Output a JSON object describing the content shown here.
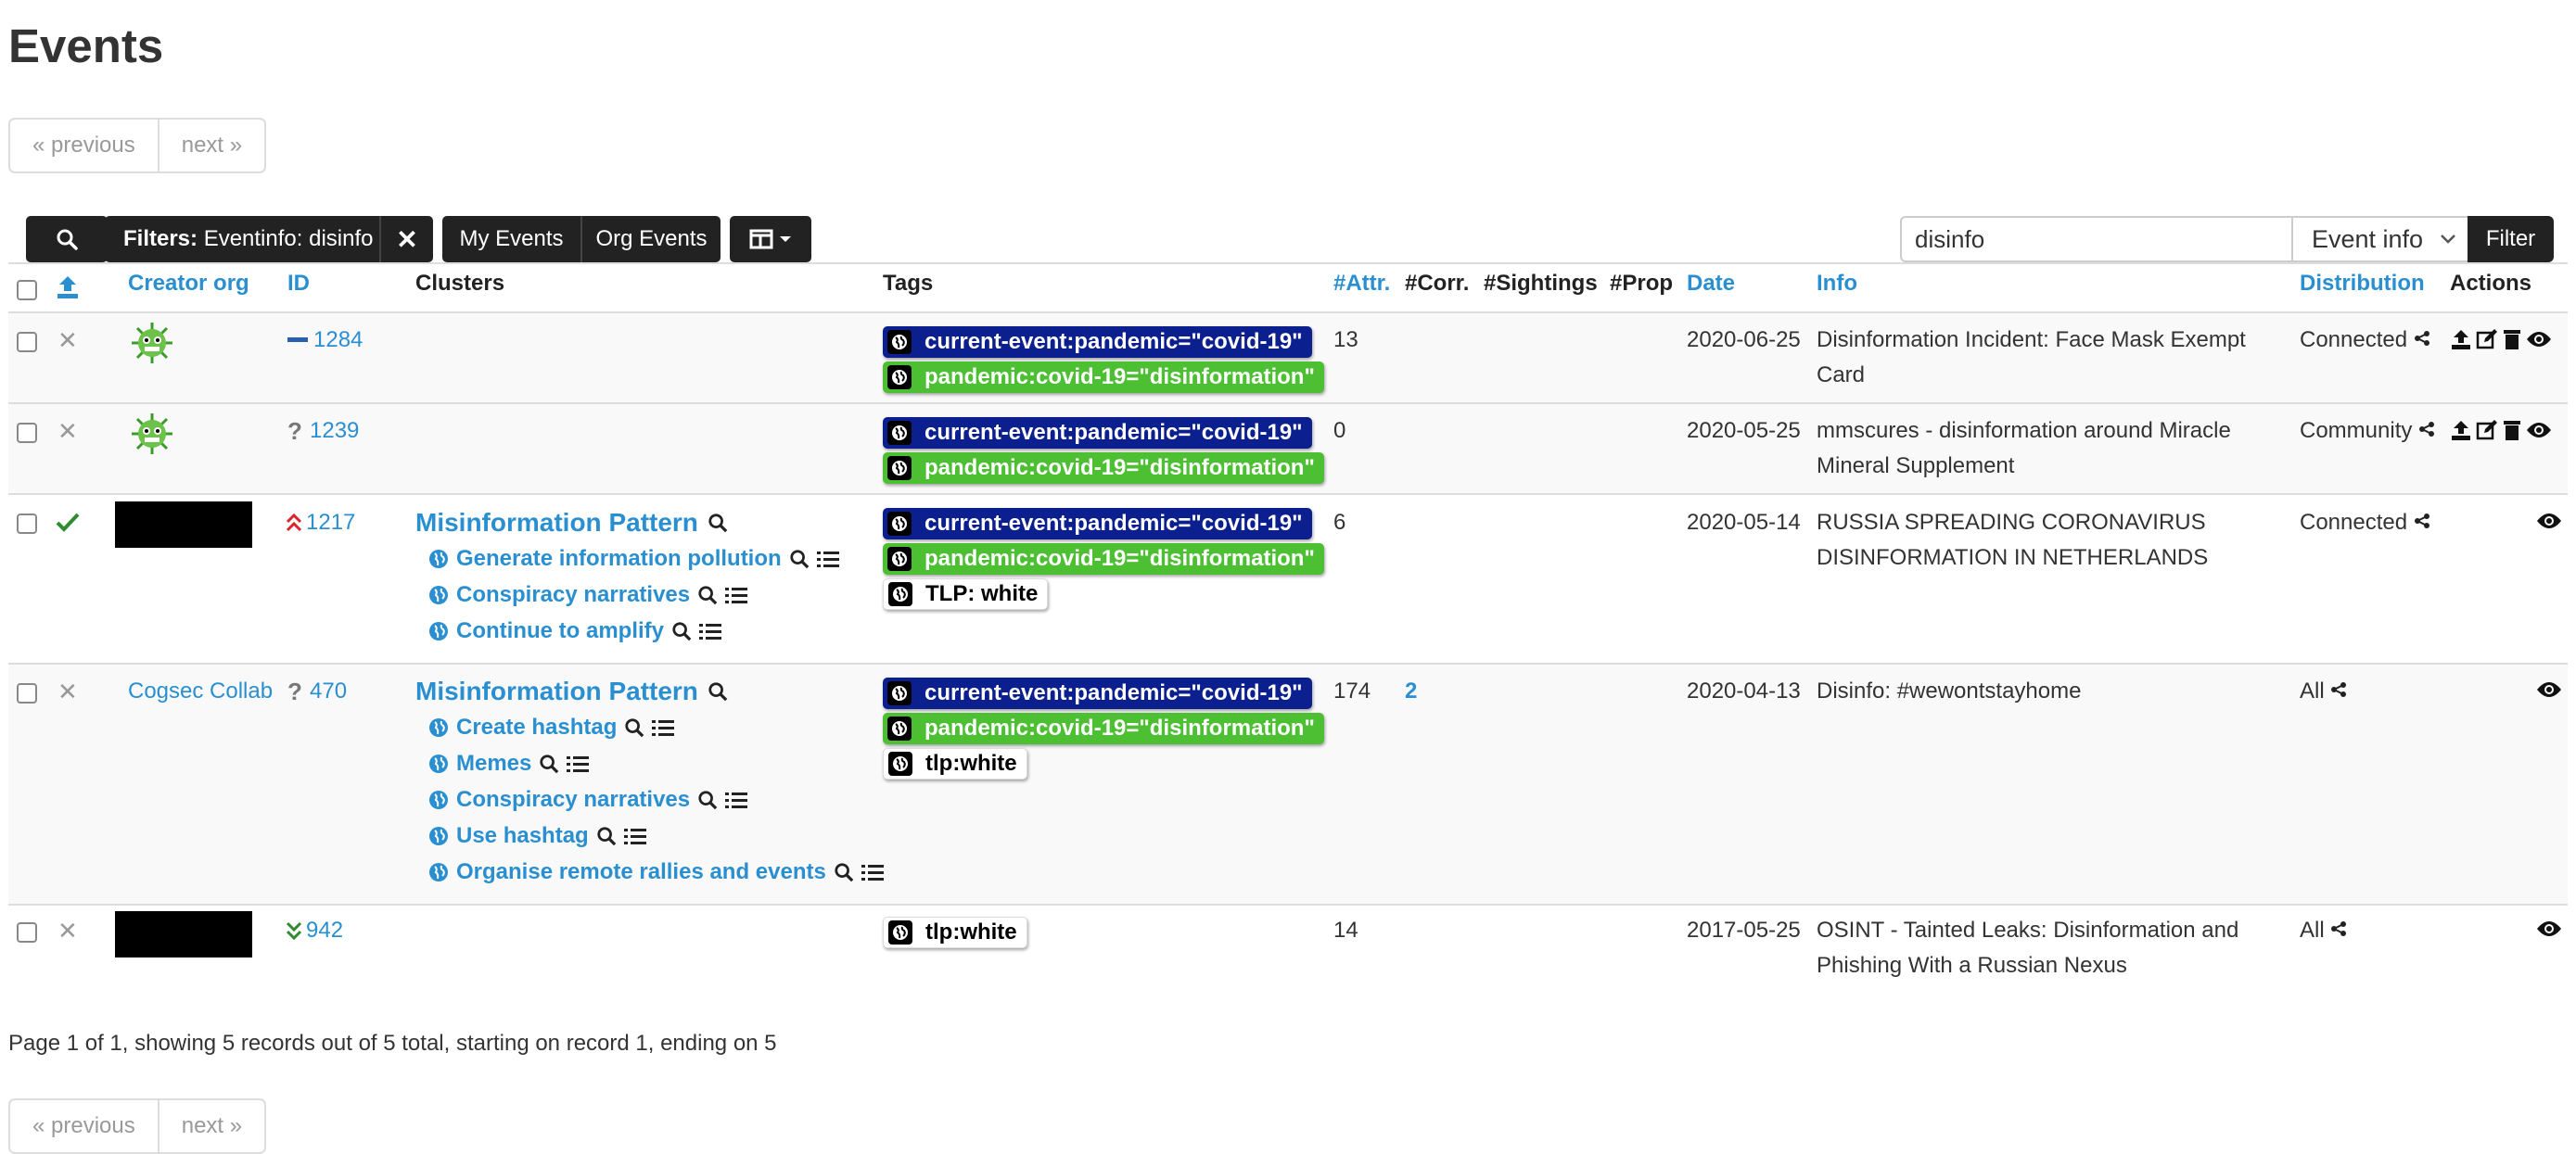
{
  "page": {
    "title": "Events"
  },
  "pagination": {
    "previous": "« previous",
    "next": "next »"
  },
  "toolbar": {
    "filters_label": "Filters:",
    "filters_value": "Eventinfo: disinfo",
    "my_events": "My Events",
    "org_events": "Org Events"
  },
  "search": {
    "value": "disinfo",
    "field": "Event info",
    "submit": "Filter"
  },
  "columns": {
    "creator_org": "Creator org",
    "id": "ID",
    "clusters": "Clusters",
    "tags": "Tags",
    "attr": "#Attr.",
    "corr": "#Corr.",
    "sightings": "#Sightings",
    "prop": "#Prop",
    "date": "Date",
    "info": "Info",
    "distribution": "Distribution",
    "actions": "Actions"
  },
  "rows": [
    {
      "published": false,
      "creator": "",
      "threat_level": "low",
      "id": "1284",
      "tags": [
        "current-event:pandemic=\"covid-19\"",
        "pandemic:covid-19=\"disinformation\""
      ],
      "attr": "13",
      "corr": "",
      "date": "2020-06-25",
      "info": "Disinformation Incident: Face Mask Exempt Card",
      "distribution": "Connected"
    },
    {
      "published": false,
      "creator": "",
      "threat_level": "undefined",
      "id": "1239",
      "tags": [
        "current-event:pandemic=\"covid-19\"",
        "pandemic:covid-19=\"disinformation\""
      ],
      "attr": "0",
      "corr": "",
      "date": "2020-05-25",
      "info": "mmscures - disinformation around Miracle Mineral Supplement",
      "distribution": "Community"
    },
    {
      "published": true,
      "creator": "",
      "threat_level": "high",
      "id": "1217",
      "cluster_title": "Misinformation Pattern",
      "clusters": [
        "Generate information pollution",
        "Conspiracy narratives",
        "Continue to amplify"
      ],
      "tags": [
        "current-event:pandemic=\"covid-19\"",
        "pandemic:covid-19=\"disinformation\"",
        "TLP: white"
      ],
      "attr": "6",
      "corr": "",
      "date": "2020-05-14",
      "info": "RUSSIA SPREADING CORONAVIRUS DISINFORMATION IN NETHERLANDS",
      "distribution": "Connected"
    },
    {
      "published": false,
      "creator": "Cogsec Collab",
      "threat_level": "undefined",
      "id": "470",
      "cluster_title": "Misinformation Pattern",
      "clusters": [
        "Create hashtag",
        "Memes",
        "Conspiracy narratives",
        "Use hashtag",
        "Organise remote rallies and events"
      ],
      "tags": [
        "current-event:pandemic=\"covid-19\"",
        "pandemic:covid-19=\"disinformation\"",
        "tlp:white"
      ],
      "attr": "174",
      "corr": "2",
      "date": "2020-04-13",
      "info": "Disinfo: #wewontstayhome",
      "distribution": "All"
    },
    {
      "published": false,
      "creator": "",
      "threat_level": "low-green",
      "id": "942",
      "tags": [
        "tlp:white"
      ],
      "attr": "14",
      "corr": "",
      "date": "2017-05-25",
      "info": "OSINT - Tainted Leaks: Disinformation and Phishing With a Russian Nexus",
      "distribution": "All"
    }
  ],
  "footer": {
    "summary": "Page 1 of 1, showing 5 records out of 5 total, starting on record 1, ending on 5"
  },
  "colors": {
    "link": "#2a8fd1",
    "tag_blue": "#0b1f8f",
    "tag_green": "#4cbf33",
    "dark_button": "#222222"
  }
}
